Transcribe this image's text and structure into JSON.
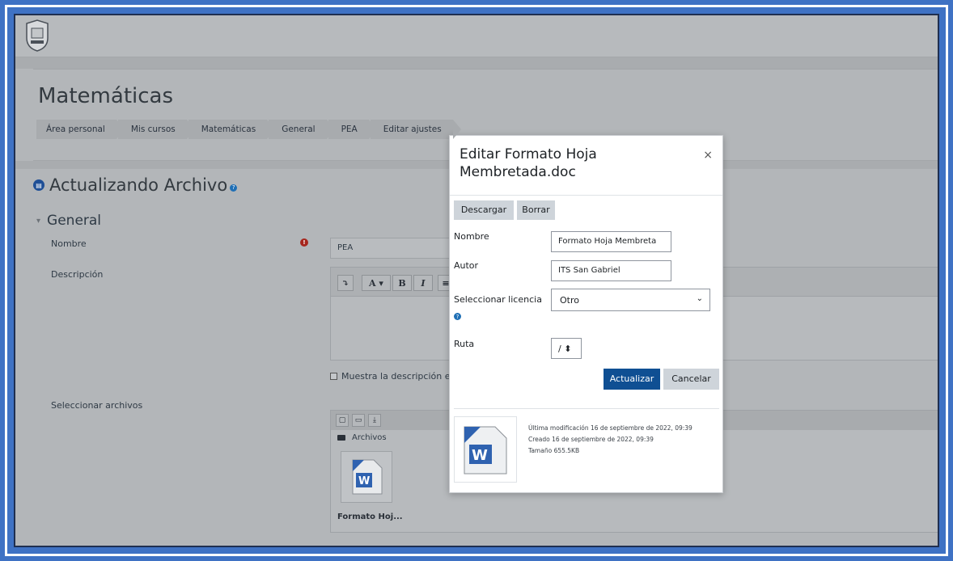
{
  "course": {
    "title": "Matemáticas",
    "breadcrumb": [
      "Área personal",
      "Mis cursos",
      "Matemáticas",
      "General",
      "PEA",
      "Editar ajustes"
    ]
  },
  "page": {
    "heading": "Actualizando Archivo",
    "section": "General"
  },
  "form": {
    "nombre_label": "Nombre",
    "nombre_value": "PEA",
    "descripcion_label": "Descripción",
    "checkbox_label": "Muestra la descripción e",
    "seleccionar_label": "Seleccionar archivos",
    "files_path": "Archivos",
    "file_name": "Formato Hoj..."
  },
  "editor": {
    "buttons": [
      "⤵",
      "A ▾",
      "B",
      "I",
      "≡"
    ]
  },
  "modal": {
    "title": "Editar Formato Hoja Membretada.doc",
    "close": "×",
    "download_label": "Descargar",
    "delete_label": "Borrar",
    "nombre_label": "Nombre",
    "nombre_value": "Formato Hoja Membreta",
    "autor_label": "Autor",
    "autor_value": "ITS San Gabriel",
    "licencia_label": "Seleccionar licencia",
    "licencia_value": "Otro",
    "ruta_label": "Ruta",
    "ruta_value": "/ ⬍",
    "update_label": "Actualizar",
    "cancel_label": "Cancelar",
    "meta": {
      "modified": "Última modificación  16 de septiembre de 2022, 09:39",
      "created": "Creado  16 de septiembre de 2022, 09:39",
      "size": "Tamaño  655.5KB"
    }
  },
  "colors": {
    "frame": "#3f72c4",
    "primary": "#0f4f93",
    "secondary": "#ced4da",
    "required": "#a6261d",
    "info": "#1f6fb5"
  }
}
